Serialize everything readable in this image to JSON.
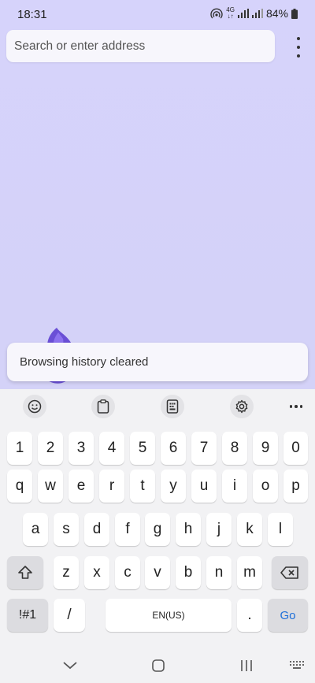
{
  "status": {
    "time": "18:31",
    "network": "4G",
    "battery": "84%"
  },
  "browser": {
    "address_placeholder": "Search or enter address",
    "menu_icon": "more-vertical-icon"
  },
  "toast": {
    "message": "Browsing history cleared"
  },
  "keyboard": {
    "toolbar": [
      "emoji-icon",
      "clipboard-icon",
      "keypad-icon",
      "settings-icon",
      "more-horizontal-icon"
    ],
    "number_row": [
      "1",
      "2",
      "3",
      "4",
      "5",
      "6",
      "7",
      "8",
      "9",
      "0"
    ],
    "row1": [
      "q",
      "w",
      "e",
      "r",
      "t",
      "y",
      "u",
      "i",
      "o",
      "p"
    ],
    "row2": [
      "a",
      "s",
      "d",
      "f",
      "g",
      "h",
      "j",
      "k",
      "l"
    ],
    "row3": [
      "z",
      "x",
      "c",
      "v",
      "b",
      "n",
      "m"
    ],
    "symbols_label": "!#1",
    "slash_label": "/",
    "space_label": "EN(US)",
    "period_label": ".",
    "go_label": "Go"
  },
  "colors": {
    "background": "#d6d3fb",
    "go_text": "#1e6fd9"
  }
}
